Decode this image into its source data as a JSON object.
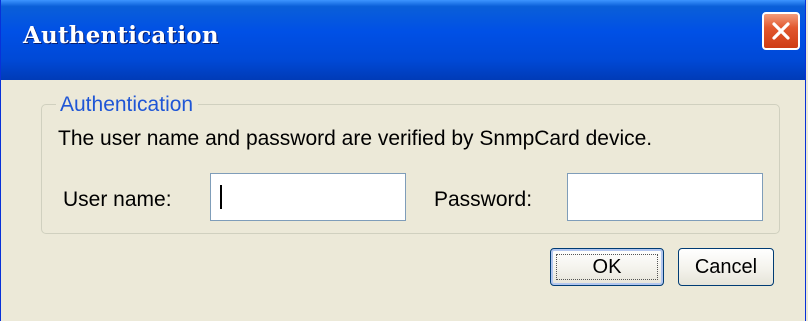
{
  "window": {
    "title": "Authentication",
    "close_icon": "close-icon"
  },
  "group": {
    "legend": "Authentication",
    "description": "The user name and password are verified by SnmpCard device."
  },
  "form": {
    "username_label": "User name:",
    "username_value": "",
    "password_label": "Password:",
    "password_value": ""
  },
  "buttons": {
    "ok_label": "OK",
    "cancel_label": "Cancel"
  },
  "colors": {
    "titlebar": "#0050e6",
    "legend_text": "#1f56d6",
    "close_button": "#e2582f",
    "background": "#ece9d8"
  }
}
